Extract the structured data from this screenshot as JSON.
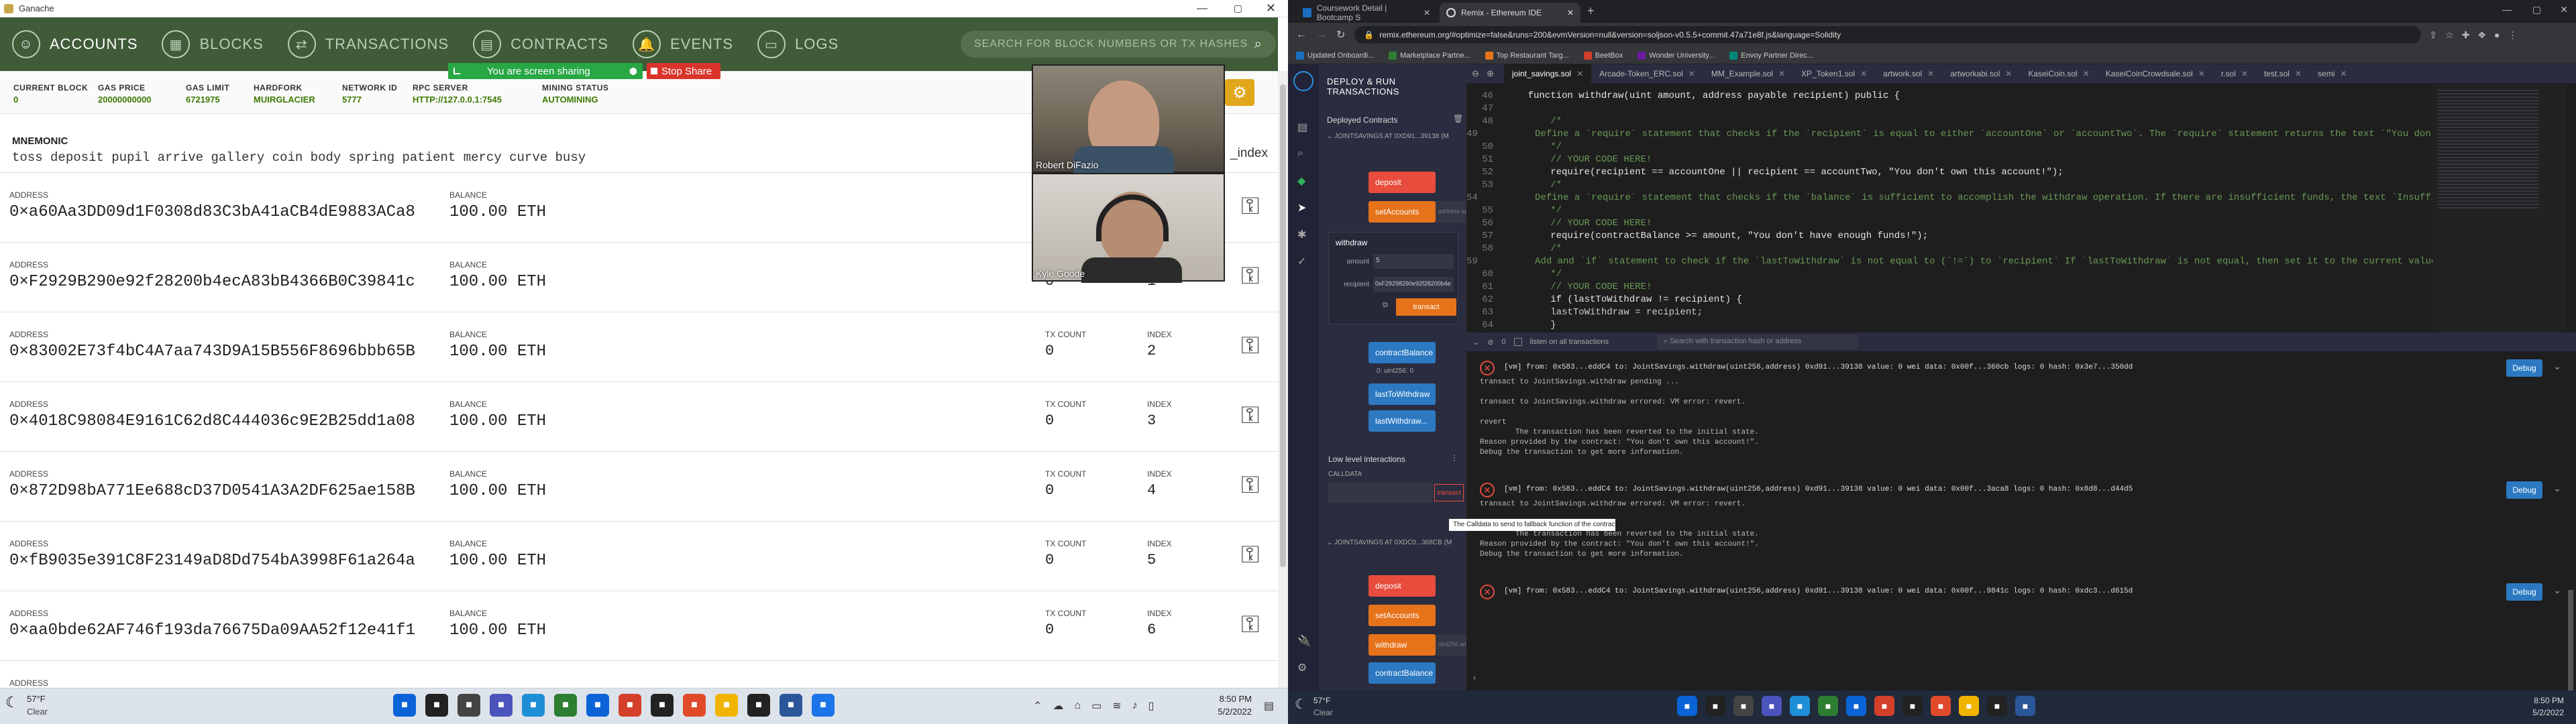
{
  "ganache": {
    "title": "Ganache",
    "nav": [
      "ACCOUNTS",
      "BLOCKS",
      "TRANSACTIONS",
      "CONTRACTS",
      "EVENTS",
      "LOGS"
    ],
    "search_placeholder": "SEARCH FOR BLOCK NUMBERS OR TX HASHES",
    "stats": [
      {
        "label": "CURRENT BLOCK",
        "value": "0"
      },
      {
        "label": "GAS PRICE",
        "value": "20000000000"
      },
      {
        "label": "GAS LIMIT",
        "value": "6721975"
      },
      {
        "label": "HARDFORK",
        "value": "MUIRGLACIER"
      },
      {
        "label": "NETWORK ID",
        "value": "5777"
      },
      {
        "label": "RPC SERVER",
        "value": "HTTP://127.0.0.1:7545"
      },
      {
        "label": "MINING STATUS",
        "value": "AUTOMINING"
      }
    ],
    "share_banner": "You are screen sharing",
    "stop_share": "Stop Share",
    "mnemonic_label": "MNEMONIC",
    "mnemonic": "toss deposit pupil arrive gallery coin body spring patient mercy curve busy",
    "hd_path_label": "_index",
    "col_address": "ADDRESS",
    "col_balance": "BALANCE",
    "col_tx": "TX COUNT",
    "col_index": "INDEX",
    "accounts": [
      {
        "address": "0×a60Aa3DD09d1F0308d83C3bA41aCB4dE9883ACa8",
        "balance": "100.00 ETH",
        "tx": "",
        "index": ""
      },
      {
        "address": "0×F2929B290e92f28200b4ecA83bB4366B0C39841c",
        "balance": "100.00 ETH",
        "tx": "0",
        "index": "1"
      },
      {
        "address": "0×83002E73f4bC4A7aa743D9A15B556F8696bbb65B",
        "balance": "100.00 ETH",
        "tx": "0",
        "index": "2"
      },
      {
        "address": "0×4018C98084E9161C62d8C444036c9E2B25dd1a08",
        "balance": "100.00 ETH",
        "tx": "0",
        "index": "3"
      },
      {
        "address": "0×872D98bA771Ee688cD37D0541A3A2DF625ae158B",
        "balance": "100.00 ETH",
        "tx": "0",
        "index": "4"
      },
      {
        "address": "0×fB9035e391C8F23149aD8Dd754bA3998F61a264a",
        "balance": "100.00 ETH",
        "tx": "0",
        "index": "5"
      },
      {
        "address": "0×aa0bde62AF746f193da76675Da09AA52f12e41f1",
        "balance": "100.00 ETH",
        "tx": "0",
        "index": "6"
      }
    ],
    "partial_label": "ADDRESS"
  },
  "video": {
    "p1": "Robert DiFazio",
    "p2": "Kyle Goode"
  },
  "taskbar_left": {
    "temp": "57°F",
    "cond": "Clear",
    "time": "8:50 PM",
    "date": "5/2/2022"
  },
  "taskbar_right": {
    "temp": "57°F",
    "cond": "Clear",
    "time": "8:50 PM",
    "date": "5/2/2022"
  },
  "browser": {
    "tabs": [
      "Coursework Detail | Bootcamp S",
      "Remix - Ethereum IDE"
    ],
    "url": "remix.ethereum.org/#optimize=false&runs=200&evmVersion=null&version=soljson-v0.5.5+commit.47a71e8f.js&language=Solidity",
    "bookmarks": [
      "Updated Onboardi...",
      "Marketplace Partne...",
      "Top Restaurant Targ...",
      "BeetBox",
      "Wonder University...",
      "Envoy Partner Direc..."
    ]
  },
  "remix": {
    "panel_title": "DEPLOY & RUN TRANSACTIONS",
    "deployed": "Deployed Contracts",
    "instance1": "JOINTSAVINGS AT 0XD91...39138 (M",
    "instance2": "JOINTSAVINGS AT 0XDC0...368CB (M",
    "deposit": "deposit",
    "setAccounts": "setAccounts",
    "setAccounts_ph": "address accountOne, address",
    "withdraw": "withdraw",
    "amount_label": "amount",
    "amount_val": "5",
    "recipient_label": "recipient",
    "recipient_val": "0xF29298290e92f28200b4e",
    "transact": "transact",
    "contractBalance": "contractBalance",
    "uint_res": "0: uint256: 0",
    "lastToWithdraw": "lastToWithdraw",
    "lastWithdraw": "lastWithdraw...",
    "low_level": "Low level interactions",
    "calldata": "CALLDATA",
    "tooltip": "The Calldata to send to fallback function of the contract.",
    "withdraw2_ph": "uint256 amount, address p",
    "file_tabs": [
      "joint_savings.sol",
      "Arcade-Token_ERC.sol",
      "MM_Example.sol",
      "XP_Token1.sol",
      "artwork.sol",
      "artworkabi.sol",
      "KaseiCoin.sol",
      "KaseiCoinCrowdsale.sol",
      "r.sol",
      "test.sol",
      "semi"
    ],
    "code_lines": [
      {
        "n": "46",
        "t": "    function withdraw(uint amount, address payable recipient) public {"
      },
      {
        "n": "47",
        "t": ""
      },
      {
        "n": "48",
        "t": "        /*"
      },
      {
        "n": "49",
        "t": "        Define a `require` statement that checks if the `recipient` is equal to either `accountOne` or `accountTwo`. The `require` statement returns the text `\"You don't ow"
      },
      {
        "n": "50",
        "t": "        */"
      },
      {
        "n": "51",
        "t": "        // YOUR CODE HERE!"
      },
      {
        "n": "52",
        "t": "        require(recipient == accountOne || recipient == accountTwo, \"You don't own this account!\");"
      },
      {
        "n": "53",
        "t": "        /*"
      },
      {
        "n": "54",
        "t": "        Define a `require` statement that checks if the `balance` is sufficient to accomplish the withdraw operation. If there are insufficient funds, the text `Insufficient"
      },
      {
        "n": "55",
        "t": "        */"
      },
      {
        "n": "56",
        "t": "        // YOUR CODE HERE!"
      },
      {
        "n": "57",
        "t": "        require(contractBalance >= amount, \"You don't have enough funds!\");"
      },
      {
        "n": "58",
        "t": "        /*"
      },
      {
        "n": "59",
        "t": "        Add and `if` statement to check if the `lastToWithdraw` is not equal to (`!=`) to `recipient` If `lastToWithdraw` is not equal, then set it to the current value of"
      },
      {
        "n": "60",
        "t": "        */"
      },
      {
        "n": "61",
        "t": "        // YOUR CODE HERE!"
      },
      {
        "n": "62",
        "t": "        if (lastToWithdraw != recipient) {"
      },
      {
        "n": "63",
        "t": "        lastToWithdraw = recipient;"
      },
      {
        "n": "64",
        "t": "        }"
      }
    ],
    "terminal_listen": "listen on all transactions",
    "terminal_search": "Search with transaction hash or address",
    "terminal_count": "0",
    "logs": [
      {
        "head": "[vm] from: 0x583...eddC4 to: JointSavings.withdraw(uint256,address) 0xd91...39138 value: 0 wei data: 0x00f...360cb logs: 0 hash: 0x3e7...350dd",
        "lines": [
          "transact to JointSavings.withdraw pending ...",
          "",
          "transact to JointSavings.withdraw errored: VM error: revert.",
          "",
          "revert",
          "        The transaction has been reverted to the initial state.",
          "Reason provided by the contract: \"You don't own this account!\".",
          "Debug the transaction to get more information."
        ]
      },
      {
        "head": "[vm] from: 0x583...eddC4 to: JointSavings.withdraw(uint256,address) 0xd91...39138 value: 0 wei data: 0x00f...3aca8 logs: 0 hash: 0x8d8...d44d5",
        "lines": [
          "transact to JointSavings.withdraw errored: VM error: revert.",
          "",
          "revert",
          "        The transaction has been reverted to the initial state.",
          "Reason provided by the contract: \"You don't own this account!\".",
          "Debug the transaction to get more information."
        ]
      },
      {
        "head": "[vm] from: 0x583...eddC4 to: JointSavings.withdraw(uint256,address) 0xd91...39138 value: 0 wei data: 0x00f...9841c logs: 0 hash: 0xdc3...d615d",
        "lines": []
      }
    ],
    "debug": "Debug"
  }
}
